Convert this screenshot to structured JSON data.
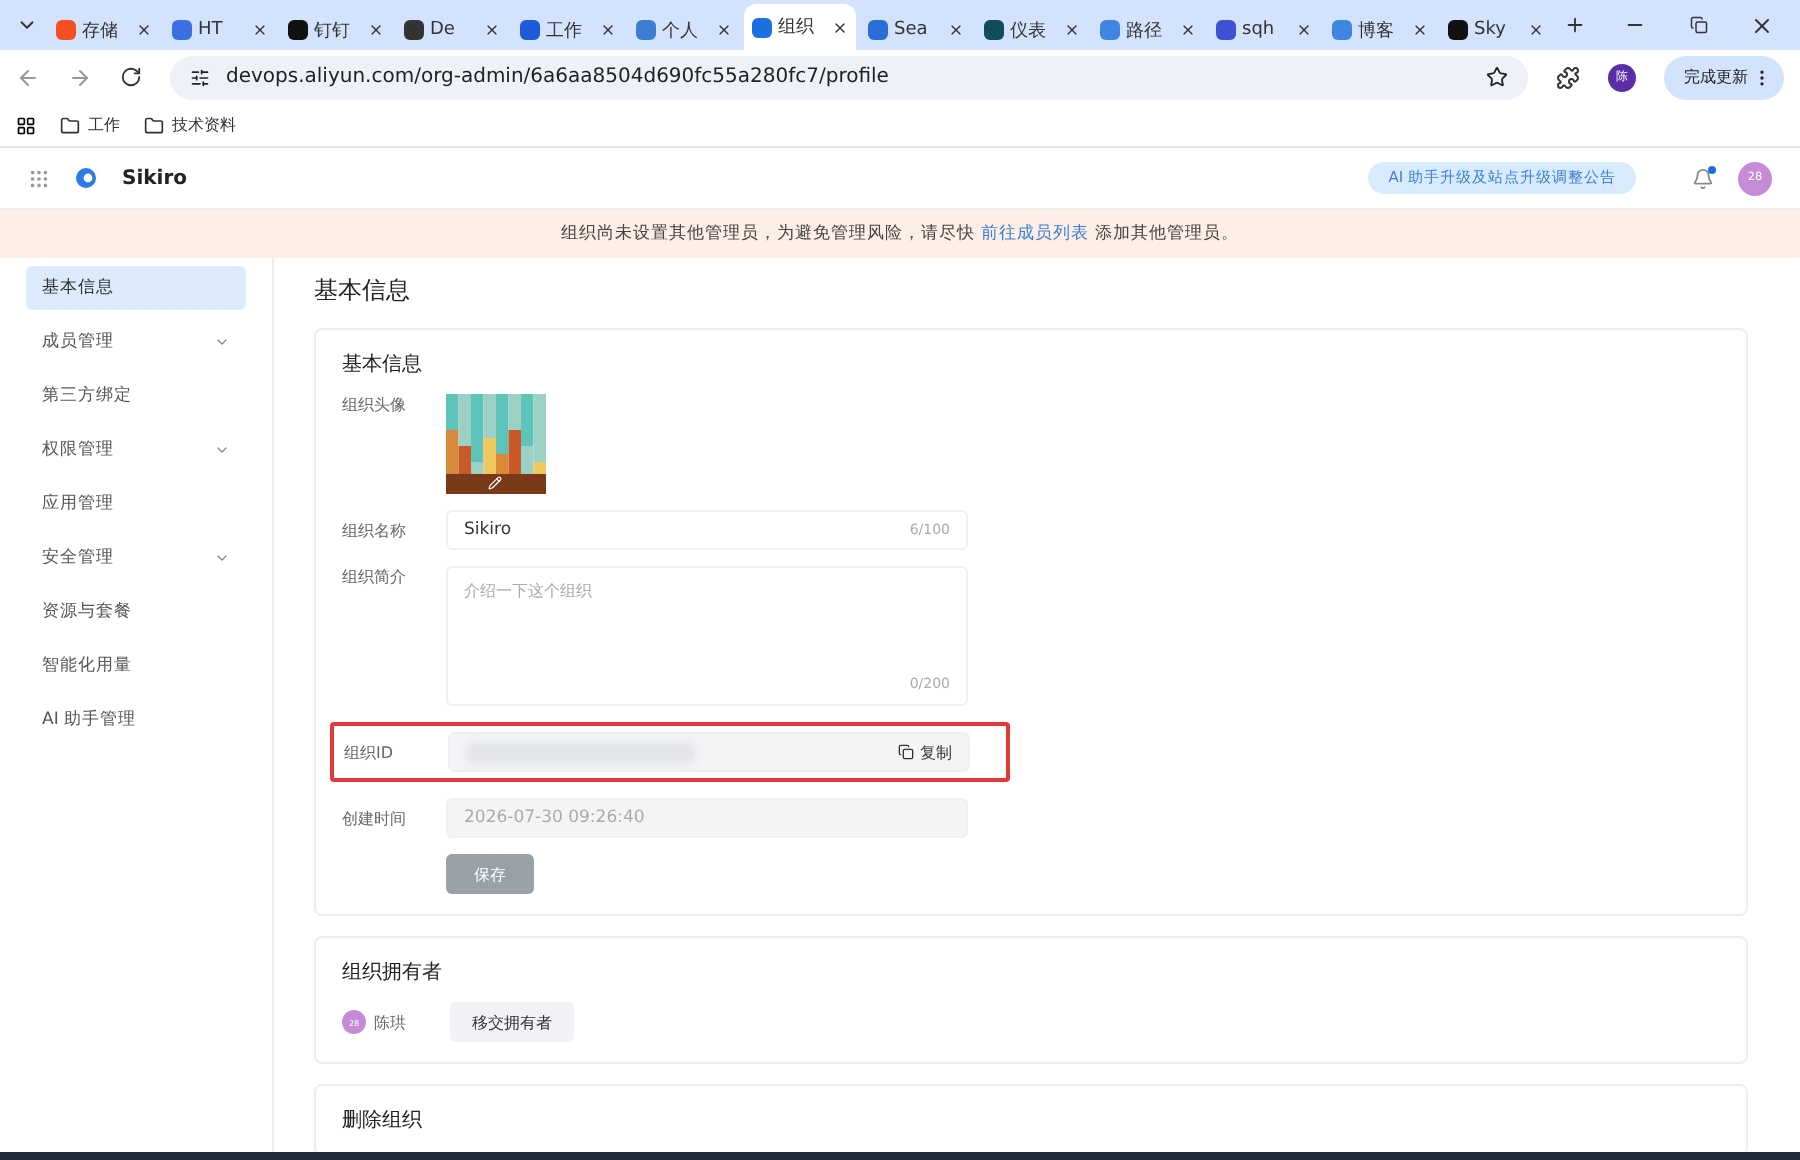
{
  "browser": {
    "tabs": [
      {
        "title": "存储",
        "selected": false
      },
      {
        "title": "HT",
        "selected": false
      },
      {
        "title": "钉钉",
        "selected": false
      },
      {
        "title": "De",
        "selected": false
      },
      {
        "title": "工作",
        "selected": false
      },
      {
        "title": "个人",
        "selected": false
      },
      {
        "title": "组织",
        "selected": true
      },
      {
        "title": "Sea",
        "selected": false
      },
      {
        "title": "仪表",
        "selected": false
      },
      {
        "title": "路径",
        "selected": false
      },
      {
        "title": "sqh",
        "selected": false
      },
      {
        "title": "博客",
        "selected": false
      },
      {
        "title": "Sky",
        "selected": false
      }
    ],
    "url": "devops.aliyun.com/org-admin/6a6aa8504d690fc55a280fc7/profile",
    "profile_badge": "陈",
    "update_button": "完成更新",
    "bookmarks": [
      "工作",
      "技术资料"
    ]
  },
  "app_header": {
    "org_name": "Sikiro",
    "announcement": "AI 助手升级及站点升级调整公告",
    "avatar": "28",
    "has_notification": true
  },
  "banner": {
    "text_before": "组织尚未设置其他管理员，为避免管理风险，请尽快",
    "link": "前往成员列表",
    "text_after": "添加其他管理员。"
  },
  "sidebar": {
    "items": [
      {
        "label": "基本信息",
        "selected": true,
        "expandable": false
      },
      {
        "label": "成员管理",
        "selected": false,
        "expandable": true
      },
      {
        "label": "第三方绑定",
        "selected": false,
        "expandable": false
      },
      {
        "label": "权限管理",
        "selected": false,
        "expandable": true
      },
      {
        "label": "应用管理",
        "selected": false,
        "expandable": false
      },
      {
        "label": "安全管理",
        "selected": false,
        "expandable": true
      },
      {
        "label": "资源与套餐",
        "selected": false,
        "expandable": false
      },
      {
        "label": "智能化用量",
        "selected": false,
        "expandable": false
      },
      {
        "label": "AI 助手管理",
        "selected": false,
        "expandable": false
      }
    ]
  },
  "page_title": "基本信息",
  "basic_info": {
    "title": "基本信息",
    "avatar_label": "组织头像",
    "name": {
      "label": "组织名称",
      "value": "Sikiro",
      "counter": "6/100"
    },
    "description": {
      "label": "组织简介",
      "placeholder": "介绍一下这个组织",
      "counter": "0/200"
    },
    "org_id": {
      "label": "组织ID",
      "copy": "复制",
      "highlighted": true
    },
    "created": {
      "label": "创建时间",
      "value": "2026-07-30 09:26:40"
    },
    "save": {
      "label": "保存",
      "disabled": true
    }
  },
  "owner": {
    "title": "组织拥有者",
    "avatar": "28",
    "name": "陈珙",
    "transfer": "移交拥有者"
  },
  "delete": {
    "title": "删除组织"
  }
}
